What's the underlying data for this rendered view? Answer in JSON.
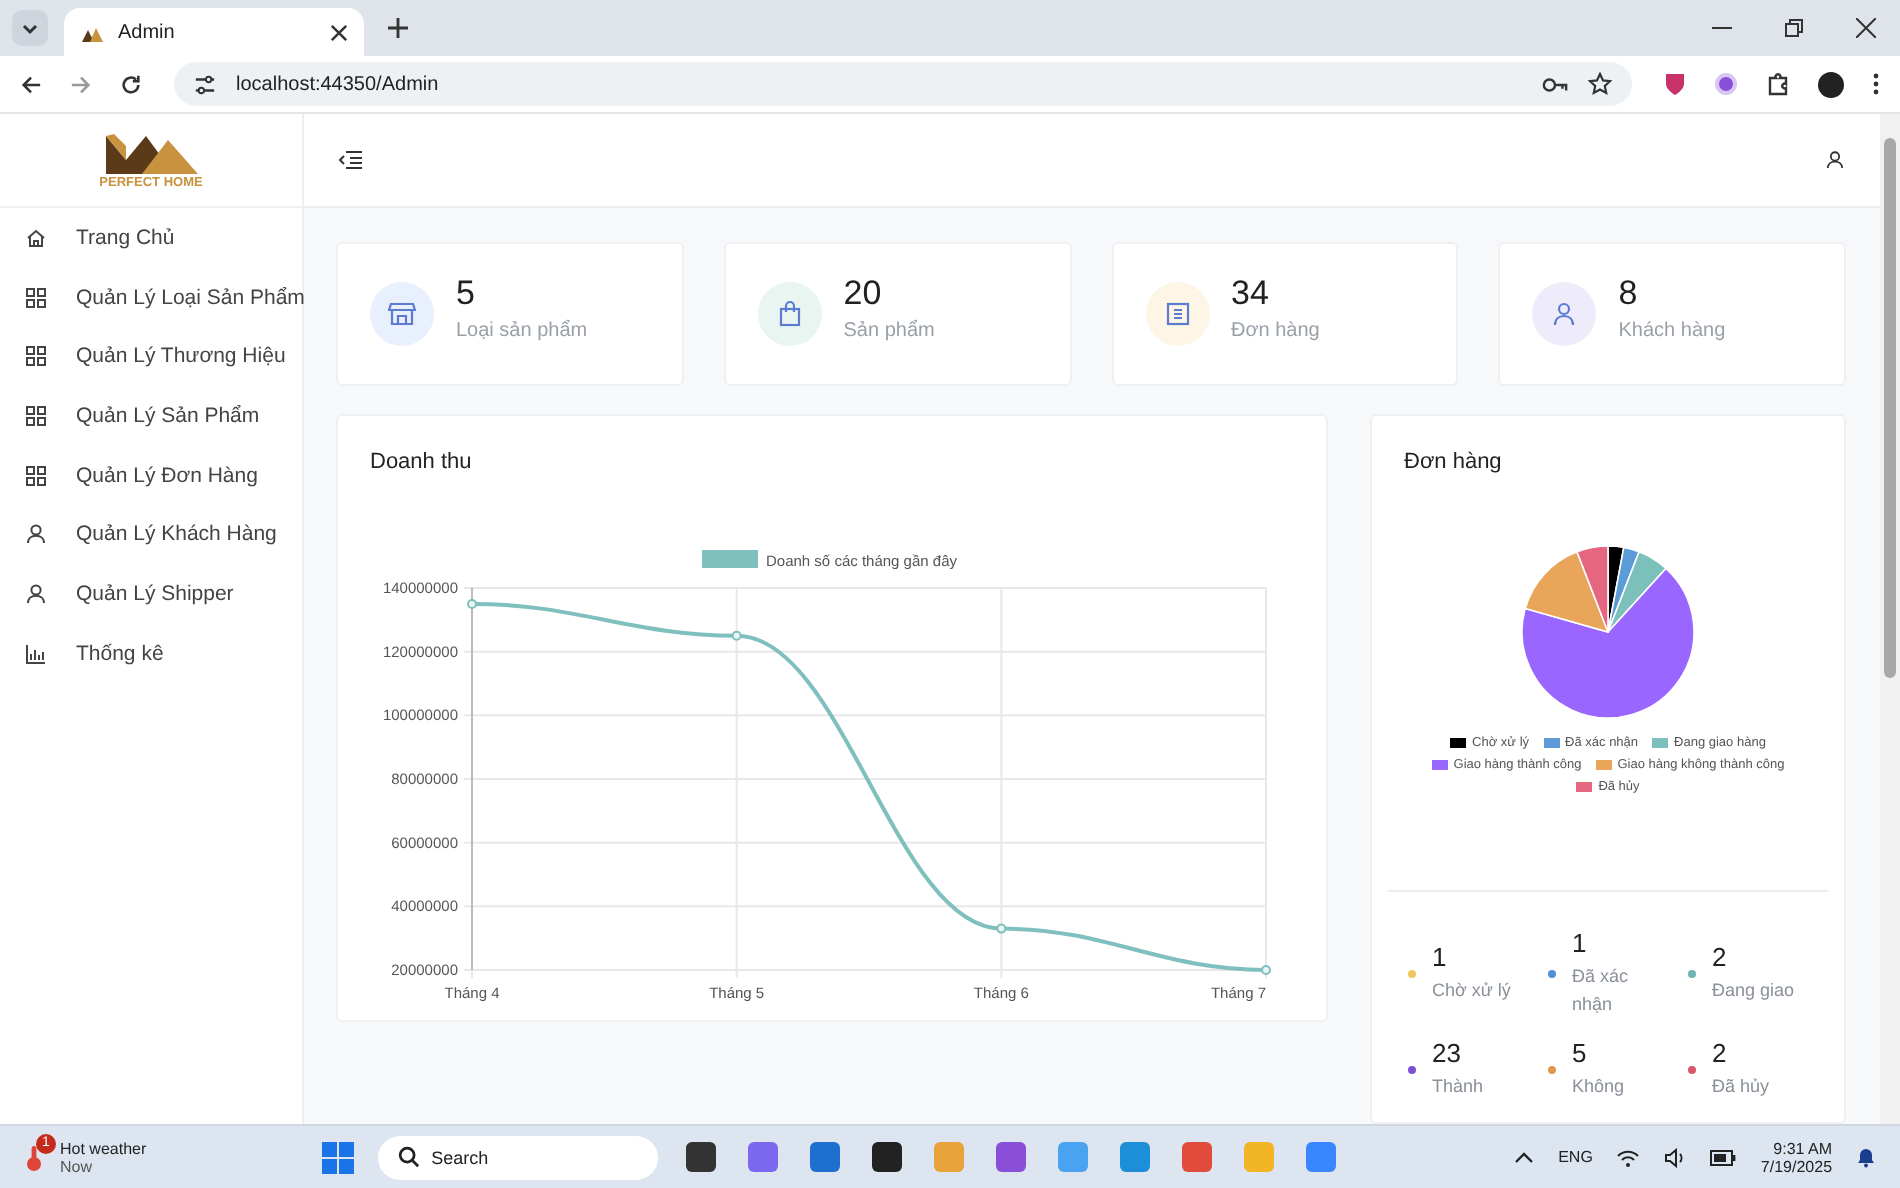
{
  "browser": {
    "tab_title": "Admin",
    "url": "localhost:44350/Admin"
  },
  "brand": {
    "name": "PERFECT HOME"
  },
  "sidebar": {
    "items": [
      {
        "label": "Trang Chủ"
      },
      {
        "label": "Quản Lý Loại Sản Phẩm"
      },
      {
        "label": "Quản Lý Thương Hiệu"
      },
      {
        "label": "Quản Lý Sản Phẩm"
      },
      {
        "label": "Quản Lý Đơn Hàng"
      },
      {
        "label": "Quản Lý Khách Hàng"
      },
      {
        "label": "Quản Lý Shipper"
      },
      {
        "label": "Thống kê"
      }
    ]
  },
  "stats": [
    {
      "value": "5",
      "label": "Loại sản phẩm"
    },
    {
      "value": "20",
      "label": "Sản phẩm"
    },
    {
      "value": "34",
      "label": "Đơn hàng"
    },
    {
      "value": "8",
      "label": "Khách hàng"
    }
  ],
  "revenue": {
    "title": "Doanh thu",
    "chart_data": {
      "type": "line",
      "categories": [
        "Tháng 4",
        "Tháng 5",
        "Tháng 6",
        "Tháng 7"
      ],
      "series": [
        {
          "name": "Doanh số các tháng gần đây",
          "color": "#7fbfbd",
          "marker": true,
          "values": [
            135000000,
            125000000,
            33000000,
            20000000
          ]
        }
      ],
      "grid": true,
      "legend": "top",
      "ylim": [
        20000000,
        140000000
      ],
      "yticks": [
        20000000,
        40000000,
        60000000,
        80000000,
        100000000,
        120000000,
        140000000
      ]
    }
  },
  "orders": {
    "title": "Đơn hàng",
    "chart_data": {
      "type": "pie",
      "categories": [
        "Chờ xử lý",
        "Đã xác nhận",
        "Đang giao hàng",
        "Giao hàng thành công",
        "Giao hàng không thành công",
        "Đã hủy"
      ],
      "values": [
        2.94,
        2.94,
        5.88,
        67.65,
        14.71,
        5.88
      ],
      "legend": "bottom",
      "colors": [
        "#000000",
        "#5b9bd8",
        "#7cc0bc",
        "#9966ff",
        "#e9a65a",
        "#e5677f"
      ]
    }
  },
  "summary": [
    {
      "value": "1",
      "label": "Chờ xử lý",
      "color": "#f0c75e"
    },
    {
      "value": "1",
      "label": "Đã xác nhận",
      "color": "#4e8fd8"
    },
    {
      "value": "2",
      "label": "Đang giao",
      "color": "#6bb5b0"
    },
    {
      "value": "23",
      "label": "Thành",
      "color": "#7b4fd6"
    },
    {
      "value": "5",
      "label": "Không",
      "color": "#e09a4a"
    },
    {
      "value": "2",
      "label": "Đã hủy",
      "color": "#d9576b"
    }
  ],
  "taskbar": {
    "weather": {
      "title": "Hot weather",
      "subtitle": "Now",
      "badge": "1"
    },
    "search": {
      "placeholder": "Search"
    },
    "language": "ENG",
    "time": "9:31 AM",
    "date": "7/19/2025"
  }
}
